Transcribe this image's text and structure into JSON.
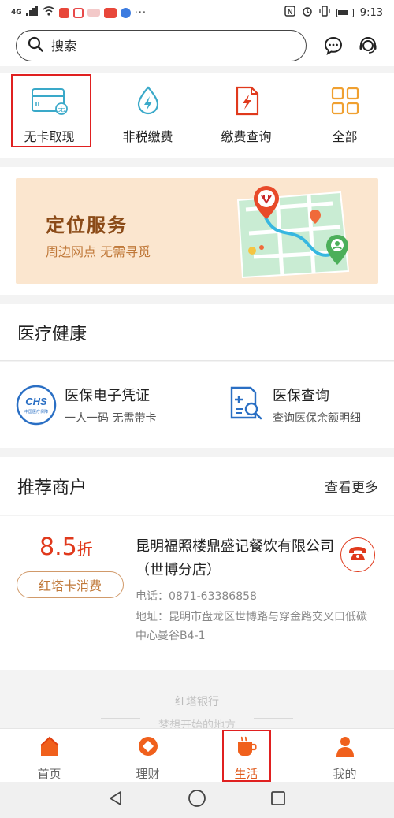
{
  "status_bar": {
    "network": "4G",
    "time": "9:13"
  },
  "search": {
    "placeholder": "搜索"
  },
  "quick_actions": [
    {
      "label": "无卡取现",
      "icon": "cardless-card-icon",
      "highlighted": true
    },
    {
      "label": "非税缴费",
      "icon": "drop-lightning-icon"
    },
    {
      "label": "缴费查询",
      "icon": "bill-lightning-icon"
    },
    {
      "label": "全部",
      "icon": "grid-icon"
    }
  ],
  "banner": {
    "title": "定位服务",
    "subtitle": "周边网点 无需寻觅"
  },
  "medical": {
    "title": "医疗健康",
    "items": [
      {
        "title": "医保电子凭证",
        "desc": "一人一码 无需带卡",
        "icon": "chs-logo-icon",
        "icon_text": "CHS",
        "icon_subtext": "中国医疗保障"
      },
      {
        "title": "医保查询",
        "desc": "查询医保余额明细",
        "icon": "insurance-query-icon"
      }
    ]
  },
  "merchants": {
    "title": "推荐商户",
    "more_label": "查看更多",
    "item": {
      "discount_value": "8.5",
      "discount_unit": "折",
      "card_tag": "红塔卡消费",
      "name": "昆明福照楼鼎盛记餐饮有限公司（世博分店）",
      "phone": "电话：0871-63386858",
      "address": "地址：昆明市盘龙区世博路与穿金路交叉口低碳中心曼谷B4-1"
    }
  },
  "footer": {
    "brand": "红塔银行",
    "slogan": "梦想开始的地方"
  },
  "tabs": [
    {
      "label": "首页",
      "icon": "home-icon"
    },
    {
      "label": "理财",
      "icon": "wealth-icon"
    },
    {
      "label": "生活",
      "icon": "coffee-cup-icon",
      "active": true
    },
    {
      "label": "我的",
      "icon": "user-icon"
    }
  ],
  "colors": {
    "accent": "#e05a1c",
    "highlight_border": "#e02020",
    "banner_bg": "#fbe6cf",
    "icon_blue": "#3aa9c9"
  }
}
